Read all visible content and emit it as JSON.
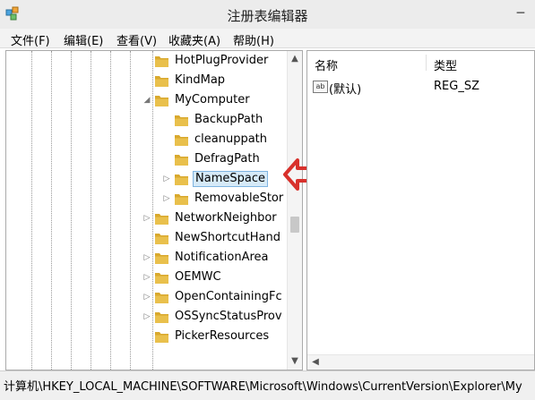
{
  "window": {
    "title": "注册表编辑器",
    "minimize_glyph": "─"
  },
  "menu": [
    "文件(F)",
    "编辑(E)",
    "查看(V)",
    "收藏夹(A)",
    "帮助(H)"
  ],
  "tree": [
    {
      "label": "HotPlugProvider",
      "expander": "",
      "selected": false
    },
    {
      "label": "KindMap",
      "expander": "",
      "selected": false
    },
    {
      "label": "MyComputer",
      "expander": "◢",
      "selected": false
    },
    {
      "label": "BackupPath",
      "expander": "",
      "selected": false
    },
    {
      "label": "cleanuppath",
      "expander": "",
      "selected": false
    },
    {
      "label": "DefragPath",
      "expander": "",
      "selected": false
    },
    {
      "label": "NameSpace",
      "expander": "▷",
      "selected": true
    },
    {
      "label": "RemovableStor",
      "expander": "▷",
      "selected": false
    },
    {
      "label": "NetworkNeighbor",
      "expander": "▷",
      "selected": false
    },
    {
      "label": "NewShortcutHand",
      "expander": "",
      "selected": false
    },
    {
      "label": "NotificationArea",
      "expander": "▷",
      "selected": false
    },
    {
      "label": "OEMWC",
      "expander": "▷",
      "selected": false
    },
    {
      "label": "OpenContainingFc",
      "expander": "▷",
      "selected": false
    },
    {
      "label": "OSSyncStatusProv",
      "expander": "▷",
      "selected": false
    },
    {
      "label": "PickerResources",
      "expander": "",
      "selected": false
    }
  ],
  "list": {
    "columns": [
      "名称",
      "类型"
    ],
    "rows": [
      {
        "icon": "ab",
        "name": "(默认)",
        "type": "REG_SZ"
      }
    ]
  },
  "status": "计算机\\HKEY_LOCAL_MACHINE\\SOFTWARE\\Microsoft\\Windows\\CurrentVersion\\Explorer\\My",
  "colors": {
    "annotation_arrow": "#d8312c",
    "selection": "#d6eaf8",
    "folder": "#e9c04c"
  },
  "scroll_glyphs": {
    "up": "▲",
    "down": "▼",
    "left": "◀"
  }
}
